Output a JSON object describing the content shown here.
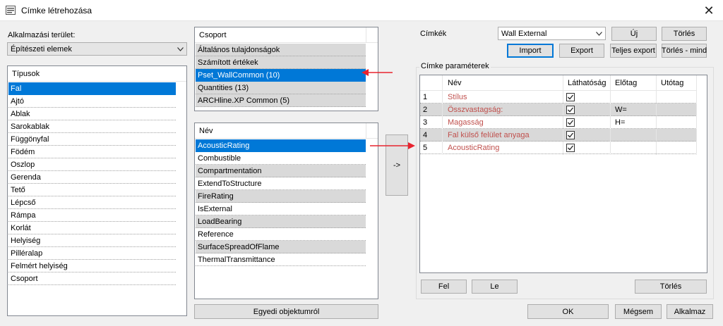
{
  "window": {
    "title": "Címke létrehozása",
    "close": "✕"
  },
  "left": {
    "area_label": "Alkalmazási terület:",
    "area_value": "Építészeti elemek",
    "types_header": "Típusok",
    "types": [
      "Fal",
      "Ajtó",
      "Ablak",
      "Sarokablak",
      "Függönyfal",
      "Födém",
      "Oszlop",
      "Gerenda",
      "Tető",
      "Lépcső",
      "Rámpa",
      "Korlát",
      "Helyiség",
      "Pilléralap",
      "Felmért helyiség",
      "Csoport"
    ]
  },
  "middle": {
    "group_header": "Csoport",
    "groups": [
      "Általános tulajdonságok",
      "Számított értékek",
      "Pset_WallCommon (10)",
      "Quantities (13)",
      "ARCHline.XP Common (5)"
    ],
    "name_header": "Név",
    "names": [
      "AcousticRating",
      "Combustible",
      "Compartmentation",
      "ExtendToStructure",
      "FireRating",
      "IsExternal",
      "LoadBearing",
      "Reference",
      "SurfaceSpreadOfFlame",
      "ThermalTransmittance"
    ],
    "add_button": "->",
    "custom_button": "Egyedi objektumról"
  },
  "right": {
    "labels_label": "Címkék",
    "labels_value": "Wall External",
    "new_button": "Új",
    "delete_button": "Törlés",
    "import_button": "Import",
    "export_button": "Export",
    "full_export_button": "Teljes export",
    "delete_all_button": "Törlés - mind",
    "params_label": "Címke paraméterek",
    "columns": {
      "num": "",
      "name": "Név",
      "visibility": "Láthatóság",
      "prefix": "Előtag",
      "suffix": "Utótag"
    },
    "rows": [
      {
        "num": "1",
        "name": "Stílus",
        "prefix": "",
        "suffix": ""
      },
      {
        "num": "2",
        "name": "Összvastagság:",
        "prefix": "W=",
        "suffix": ""
      },
      {
        "num": "3",
        "name": "Magasság",
        "prefix": "H=",
        "suffix": ""
      },
      {
        "num": "4",
        "name": "Fal külső felület anyaga",
        "prefix": "",
        "suffix": ""
      },
      {
        "num": "5",
        "name": "AcousticRating",
        "prefix": "",
        "suffix": ""
      }
    ],
    "up_button": "Fel",
    "down_button": "Le",
    "delete_row_button": "Törlés"
  },
  "footer": {
    "ok": "OK",
    "cancel": "Mégsem",
    "apply": "Alkalmaz"
  },
  "colors": {
    "selection": "#0078d7",
    "alt_row": "#d9d9d9",
    "param_text": "#c0504d",
    "arrow": "#e8242f"
  }
}
